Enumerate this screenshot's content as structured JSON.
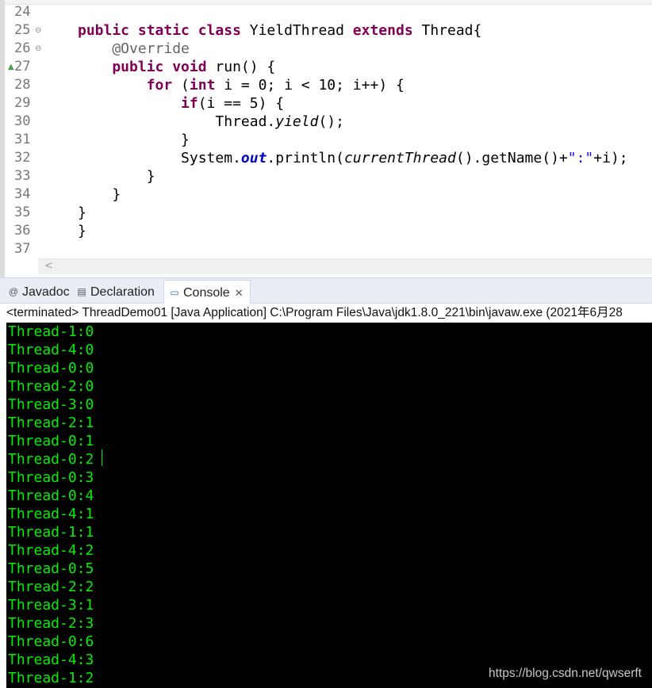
{
  "editor": {
    "lines": [
      {
        "num": "24"
      },
      {
        "num": "25",
        "fold": "⊖",
        "parts": [
          [
            "kw",
            "public static class "
          ],
          [
            "",
            "YieldThread "
          ],
          [
            "kw",
            "extends "
          ],
          [
            "",
            "Thread{"
          ]
        ]
      },
      {
        "num": "26",
        "fold": "⊖",
        "parts": [
          [
            "ann",
            "    @Override"
          ]
        ]
      },
      {
        "num": "27",
        "marker": "▲",
        "parts": [
          [
            "kw",
            "    public void "
          ],
          [
            "",
            "run() {"
          ]
        ]
      },
      {
        "num": "28",
        "parts": [
          [
            "kw",
            "        for "
          ],
          [
            "",
            "("
          ],
          [
            "kw",
            "int "
          ],
          [
            "",
            "i = 0; i < 10; i++) {"
          ]
        ]
      },
      {
        "num": "29",
        "parts": [
          [
            "kw",
            "            if"
          ],
          [
            "",
            "(i == 5) {"
          ]
        ]
      },
      {
        "num": "30",
        "parts": [
          [
            "",
            "                Thread."
          ],
          [
            "it",
            "yield"
          ],
          [
            "",
            "();"
          ]
        ]
      },
      {
        "num": "31",
        "parts": [
          [
            "",
            "            }"
          ]
        ]
      },
      {
        "num": "32",
        "parts": [
          [
            "",
            "            System."
          ],
          [
            "fld",
            "out"
          ],
          [
            "",
            "."
          ],
          [
            "",
            "println("
          ],
          [
            "it",
            "currentThread"
          ],
          [
            "",
            "().getName()+"
          ],
          [
            "str",
            "\":\""
          ],
          [
            "",
            "+i);"
          ]
        ]
      },
      {
        "num": "33",
        "parts": [
          [
            "",
            "        }"
          ]
        ]
      },
      {
        "num": "34",
        "parts": [
          [
            "",
            "    }"
          ]
        ]
      },
      {
        "num": "35",
        "parts": [
          [
            "",
            "}"
          ]
        ]
      },
      {
        "num": "36",
        "parts": [
          [
            "",
            "}"
          ]
        ]
      },
      {
        "num": "37"
      }
    ],
    "scroll_left_arrow": "<"
  },
  "tabs": [
    {
      "id": "javadoc",
      "icon": "@",
      "label": "Javadoc"
    },
    {
      "id": "declaration",
      "icon": "▤",
      "label": "Declaration"
    },
    {
      "id": "console",
      "icon": "▭",
      "label": "Console",
      "close": "✕",
      "active": true
    }
  ],
  "console": {
    "status": "<terminated> ThreadDemo01 [Java Application] C:\\Program Files\\Java\\jdk1.8.0_221\\bin\\javaw.exe (2021年6月28",
    "output": [
      "Thread-1:0",
      "Thread-4:0",
      "Thread-0:0",
      "Thread-2:0",
      "Thread-3:0",
      "Thread-2:1",
      "Thread-0:1",
      "Thread-0:2",
      "Thread-0:3",
      "Thread-0:4",
      "Thread-4:1",
      "Thread-1:1",
      "Thread-4:2",
      "Thread-0:5",
      "Thread-2:2",
      "Thread-3:1",
      "Thread-2:3",
      "Thread-0:6",
      "Thread-4:3",
      "Thread-1:2"
    ],
    "watermark": "https://blog.csdn.net/qwserft"
  },
  "colors": {
    "keyword": "#7f0055",
    "annotation": "#646464",
    "static_field": "#0000c0",
    "string": "#2a00ff",
    "console_text": "#00f000",
    "console_bg": "#000000"
  }
}
